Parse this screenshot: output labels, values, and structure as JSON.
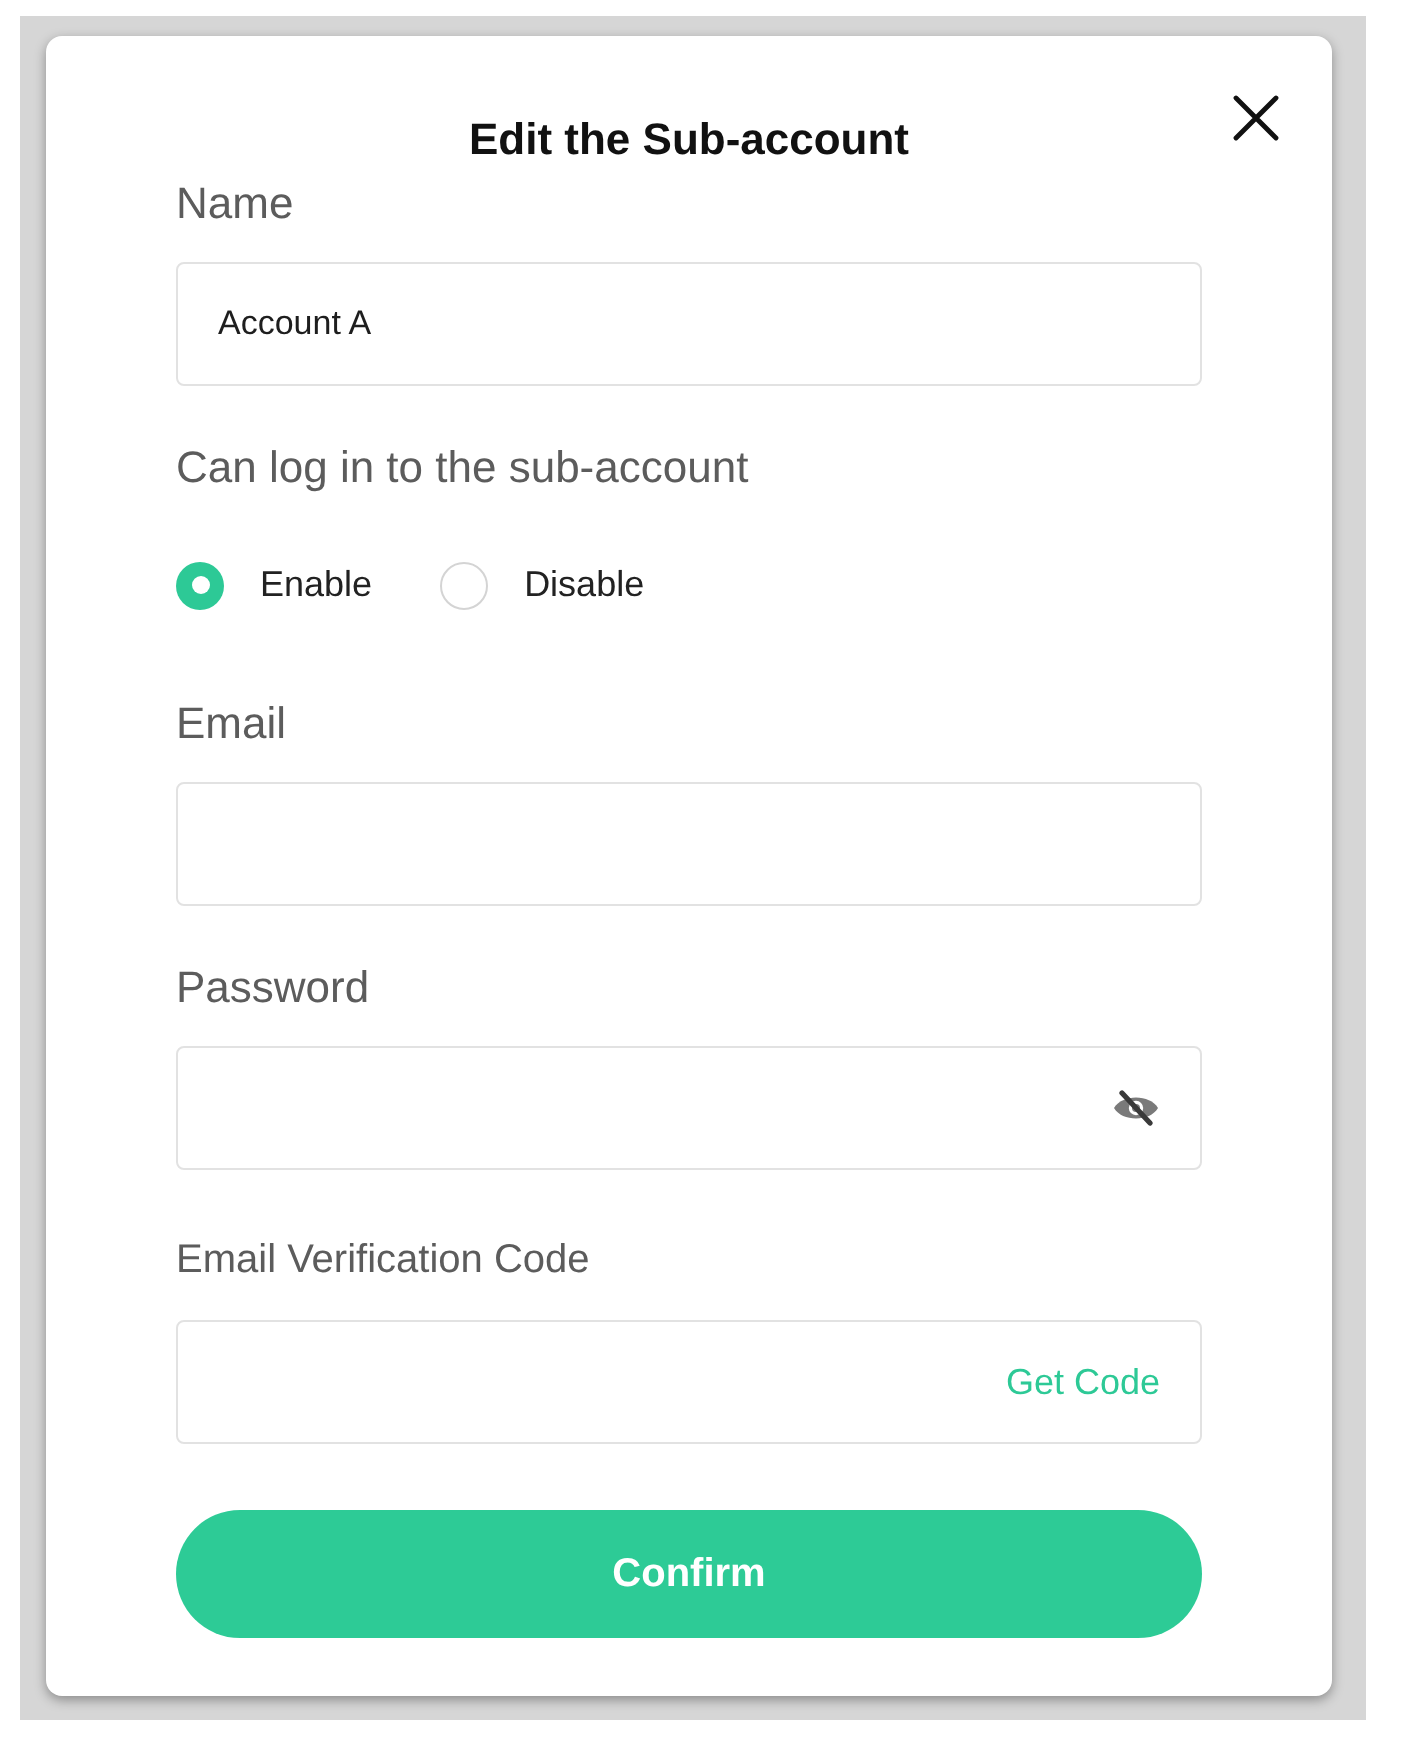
{
  "dialog": {
    "title": "Edit the Sub-account"
  },
  "form": [
    {
      "kind": "text",
      "label": "Name",
      "value": "Account A"
    },
    {
      "kind": "radio",
      "label": "Can log in to the sub-account",
      "options": [
        {
          "label": "Enable",
          "selected": true
        },
        {
          "label": "Disable",
          "selected": false
        }
      ]
    },
    {
      "kind": "text",
      "label": "Email"
    },
    {
      "kind": "password",
      "label": "Password",
      "revealed": false
    },
    {
      "kind": "code",
      "label": "Email Verification Code",
      "action": "Get Code"
    }
  ],
  "confirm_button": "Confirm"
}
